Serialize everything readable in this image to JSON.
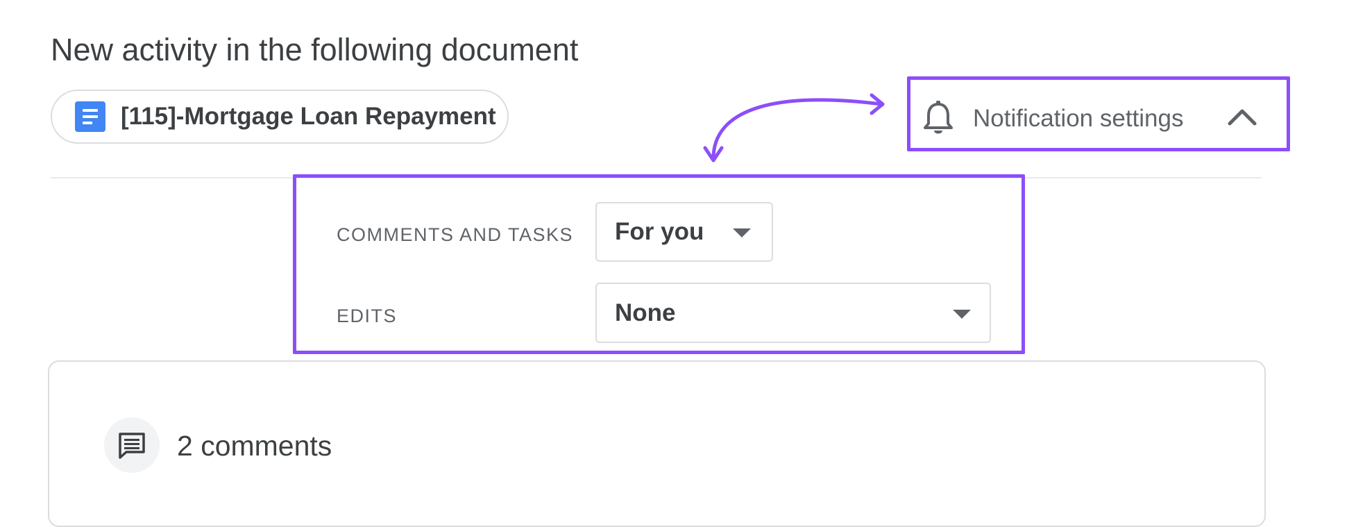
{
  "headline": "New activity in the following document",
  "document": {
    "icon": "google-docs-icon",
    "title": "[115]-Mortgage Loan Repayment"
  },
  "notification_settings": {
    "icon": "bell-icon",
    "label": "Notification settings",
    "toggle_icon": "chevron-up-icon",
    "expanded": true
  },
  "settings": {
    "comments_and_tasks": {
      "label": "COMMENTS AND TASKS",
      "selected": "For you",
      "dropdown_icon": "caret-down-icon"
    },
    "edits": {
      "label": "EDITS",
      "selected": "None",
      "dropdown_icon": "caret-down-icon"
    }
  },
  "comments_section": {
    "icon": "comment-icon",
    "label": "2 comments"
  },
  "colors": {
    "highlight": "#8c4efa",
    "docs_blue": "#4285f4",
    "text": "#3c4043",
    "muted": "#5f6368",
    "border": "#dadce0"
  }
}
